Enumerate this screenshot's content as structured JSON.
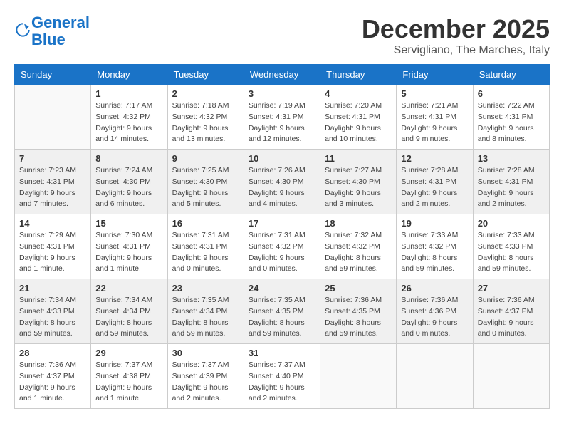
{
  "header": {
    "logo_line1": "General",
    "logo_line2": "Blue",
    "month": "December 2025",
    "location": "Servigliano, The Marches, Italy"
  },
  "weekdays": [
    "Sunday",
    "Monday",
    "Tuesday",
    "Wednesday",
    "Thursday",
    "Friday",
    "Saturday"
  ],
  "weeks": [
    [
      {
        "day": "",
        "sunrise": "",
        "sunset": "",
        "daylight": ""
      },
      {
        "day": "1",
        "sunrise": "Sunrise: 7:17 AM",
        "sunset": "Sunset: 4:32 PM",
        "daylight": "Daylight: 9 hours and 14 minutes."
      },
      {
        "day": "2",
        "sunrise": "Sunrise: 7:18 AM",
        "sunset": "Sunset: 4:32 PM",
        "daylight": "Daylight: 9 hours and 13 minutes."
      },
      {
        "day": "3",
        "sunrise": "Sunrise: 7:19 AM",
        "sunset": "Sunset: 4:31 PM",
        "daylight": "Daylight: 9 hours and 12 minutes."
      },
      {
        "day": "4",
        "sunrise": "Sunrise: 7:20 AM",
        "sunset": "Sunset: 4:31 PM",
        "daylight": "Daylight: 9 hours and 10 minutes."
      },
      {
        "day": "5",
        "sunrise": "Sunrise: 7:21 AM",
        "sunset": "Sunset: 4:31 PM",
        "daylight": "Daylight: 9 hours and 9 minutes."
      },
      {
        "day": "6",
        "sunrise": "Sunrise: 7:22 AM",
        "sunset": "Sunset: 4:31 PM",
        "daylight": "Daylight: 9 hours and 8 minutes."
      }
    ],
    [
      {
        "day": "7",
        "sunrise": "Sunrise: 7:23 AM",
        "sunset": "Sunset: 4:31 PM",
        "daylight": "Daylight: 9 hours and 7 minutes."
      },
      {
        "day": "8",
        "sunrise": "Sunrise: 7:24 AM",
        "sunset": "Sunset: 4:30 PM",
        "daylight": "Daylight: 9 hours and 6 minutes."
      },
      {
        "day": "9",
        "sunrise": "Sunrise: 7:25 AM",
        "sunset": "Sunset: 4:30 PM",
        "daylight": "Daylight: 9 hours and 5 minutes."
      },
      {
        "day": "10",
        "sunrise": "Sunrise: 7:26 AM",
        "sunset": "Sunset: 4:30 PM",
        "daylight": "Daylight: 9 hours and 4 minutes."
      },
      {
        "day": "11",
        "sunrise": "Sunrise: 7:27 AM",
        "sunset": "Sunset: 4:30 PM",
        "daylight": "Daylight: 9 hours and 3 minutes."
      },
      {
        "day": "12",
        "sunrise": "Sunrise: 7:28 AM",
        "sunset": "Sunset: 4:31 PM",
        "daylight": "Daylight: 9 hours and 2 minutes."
      },
      {
        "day": "13",
        "sunrise": "Sunrise: 7:28 AM",
        "sunset": "Sunset: 4:31 PM",
        "daylight": "Daylight: 9 hours and 2 minutes."
      }
    ],
    [
      {
        "day": "14",
        "sunrise": "Sunrise: 7:29 AM",
        "sunset": "Sunset: 4:31 PM",
        "daylight": "Daylight: 9 hours and 1 minute."
      },
      {
        "day": "15",
        "sunrise": "Sunrise: 7:30 AM",
        "sunset": "Sunset: 4:31 PM",
        "daylight": "Daylight: 9 hours and 1 minute."
      },
      {
        "day": "16",
        "sunrise": "Sunrise: 7:31 AM",
        "sunset": "Sunset: 4:31 PM",
        "daylight": "Daylight: 9 hours and 0 minutes."
      },
      {
        "day": "17",
        "sunrise": "Sunrise: 7:31 AM",
        "sunset": "Sunset: 4:32 PM",
        "daylight": "Daylight: 9 hours and 0 minutes."
      },
      {
        "day": "18",
        "sunrise": "Sunrise: 7:32 AM",
        "sunset": "Sunset: 4:32 PM",
        "daylight": "Daylight: 8 hours and 59 minutes."
      },
      {
        "day": "19",
        "sunrise": "Sunrise: 7:33 AM",
        "sunset": "Sunset: 4:32 PM",
        "daylight": "Daylight: 8 hours and 59 minutes."
      },
      {
        "day": "20",
        "sunrise": "Sunrise: 7:33 AM",
        "sunset": "Sunset: 4:33 PM",
        "daylight": "Daylight: 8 hours and 59 minutes."
      }
    ],
    [
      {
        "day": "21",
        "sunrise": "Sunrise: 7:34 AM",
        "sunset": "Sunset: 4:33 PM",
        "daylight": "Daylight: 8 hours and 59 minutes."
      },
      {
        "day": "22",
        "sunrise": "Sunrise: 7:34 AM",
        "sunset": "Sunset: 4:34 PM",
        "daylight": "Daylight: 8 hours and 59 minutes."
      },
      {
        "day": "23",
        "sunrise": "Sunrise: 7:35 AM",
        "sunset": "Sunset: 4:34 PM",
        "daylight": "Daylight: 8 hours and 59 minutes."
      },
      {
        "day": "24",
        "sunrise": "Sunrise: 7:35 AM",
        "sunset": "Sunset: 4:35 PM",
        "daylight": "Daylight: 8 hours and 59 minutes."
      },
      {
        "day": "25",
        "sunrise": "Sunrise: 7:36 AM",
        "sunset": "Sunset: 4:35 PM",
        "daylight": "Daylight: 8 hours and 59 minutes."
      },
      {
        "day": "26",
        "sunrise": "Sunrise: 7:36 AM",
        "sunset": "Sunset: 4:36 PM",
        "daylight": "Daylight: 9 hours and 0 minutes."
      },
      {
        "day": "27",
        "sunrise": "Sunrise: 7:36 AM",
        "sunset": "Sunset: 4:37 PM",
        "daylight": "Daylight: 9 hours and 0 minutes."
      }
    ],
    [
      {
        "day": "28",
        "sunrise": "Sunrise: 7:36 AM",
        "sunset": "Sunset: 4:37 PM",
        "daylight": "Daylight: 9 hours and 1 minute."
      },
      {
        "day": "29",
        "sunrise": "Sunrise: 7:37 AM",
        "sunset": "Sunset: 4:38 PM",
        "daylight": "Daylight: 9 hours and 1 minute."
      },
      {
        "day": "30",
        "sunrise": "Sunrise: 7:37 AM",
        "sunset": "Sunset: 4:39 PM",
        "daylight": "Daylight: 9 hours and 2 minutes."
      },
      {
        "day": "31",
        "sunrise": "Sunrise: 7:37 AM",
        "sunset": "Sunset: 4:40 PM",
        "daylight": "Daylight: 9 hours and 2 minutes."
      },
      {
        "day": "",
        "sunrise": "",
        "sunset": "",
        "daylight": ""
      },
      {
        "day": "",
        "sunrise": "",
        "sunset": "",
        "daylight": ""
      },
      {
        "day": "",
        "sunrise": "",
        "sunset": "",
        "daylight": ""
      }
    ]
  ]
}
